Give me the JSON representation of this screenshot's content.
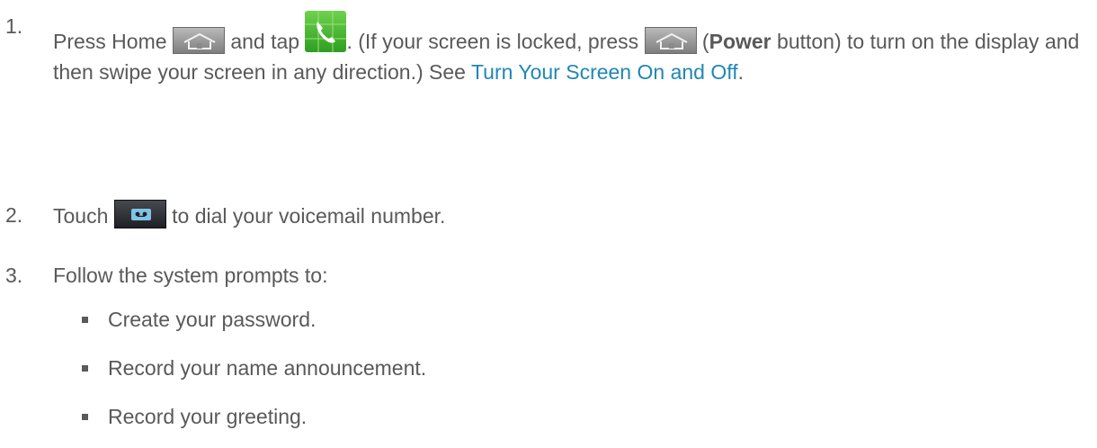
{
  "steps": [
    {
      "number": "1.",
      "text_a": "Press Home ",
      "text_b": " and tap ",
      "text_c": ". (If your screen is locked, press ",
      "text_d": " (",
      "bold": "Power",
      "text_e": " button) to turn on the display and then swipe your screen in any direction.) See ",
      "link": "Turn Your Screen On and Off",
      "text_f": "."
    },
    {
      "number": "2.",
      "text_a": "Touch ",
      "text_b": " to dial your voicemail number."
    },
    {
      "number": "3.",
      "text_a": "Follow the system prompts to:"
    }
  ],
  "sub_steps": [
    "Create your password.",
    "Record your name announcement.",
    "Record your greeting."
  ],
  "icons": {
    "home": "home-key-icon",
    "phone": "phone-app-icon",
    "voicemail": "voicemail-key-icon"
  },
  "colors": {
    "text": "#595959",
    "link": "#1f87b5",
    "phone_green": "#3db02c"
  }
}
